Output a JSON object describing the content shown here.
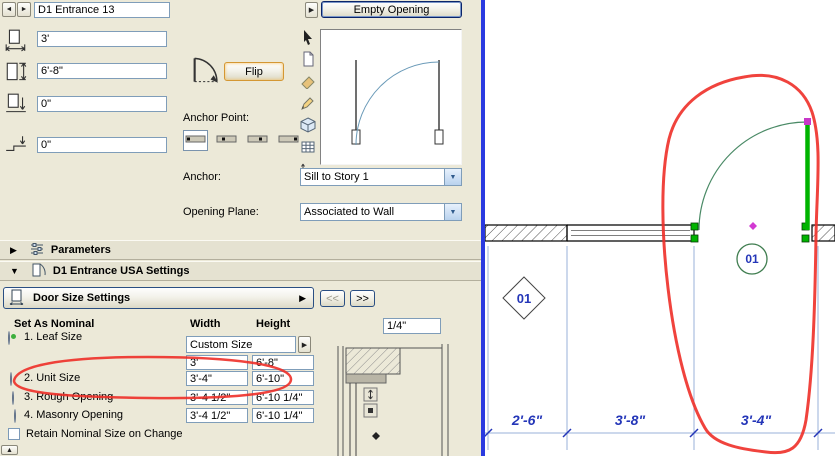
{
  "header": {
    "name_value": "D1 Entrance 13",
    "empty_opening_label": "Empty Opening"
  },
  "geometry": {
    "width_value": "3'",
    "height_value": "6'-8\"",
    "sill_value": "0\"",
    "reveal_value": "0\"",
    "flip_label": "Flip",
    "anchor_point_label": "Anchor Point:",
    "anchor_label": "Anchor:",
    "anchor_value": "Sill to Story 1",
    "opening_plane_label": "Opening Plane:",
    "opening_plane_value": "Associated to Wall"
  },
  "sections": {
    "parameters_label": "Parameters",
    "usa_settings_label": "D1 Entrance USA Settings"
  },
  "door_size": {
    "panel_label": "Door Size Settings",
    "prev_label": "<<",
    "next_label": ">>",
    "set_as_nominal_label": "Set As Nominal",
    "width_header": "Width",
    "height_header": "Height",
    "custom_size_label": "Custom Size",
    "frame_value": "1/4\"",
    "rows": [
      {
        "label": "1. Leaf Size",
        "width": "3'",
        "height": "6'-8\""
      },
      {
        "label": "2. Unit Size",
        "width": "3'-4\"",
        "height": "6'-10\""
      },
      {
        "label": "3. Rough Opening",
        "width": "3'-4 1/2\"",
        "height": "6'-10 1/4\""
      },
      {
        "label": "4. Masonry Opening",
        "width": "3'-4 1/2\"",
        "height": "6'-10 1/4\""
      }
    ],
    "retain_label": "Retain Nominal Size on Change"
  },
  "plan": {
    "door_marker": "01",
    "opening_marker": "01",
    "dim_left": "2'-6\"",
    "dim_mid": "3'-8\"",
    "dim_right": "3'-4\""
  },
  "colors": {
    "annotation_red": "#ee2f28",
    "leaf_green": "#00b400",
    "dim_blue": "#2436b8"
  }
}
